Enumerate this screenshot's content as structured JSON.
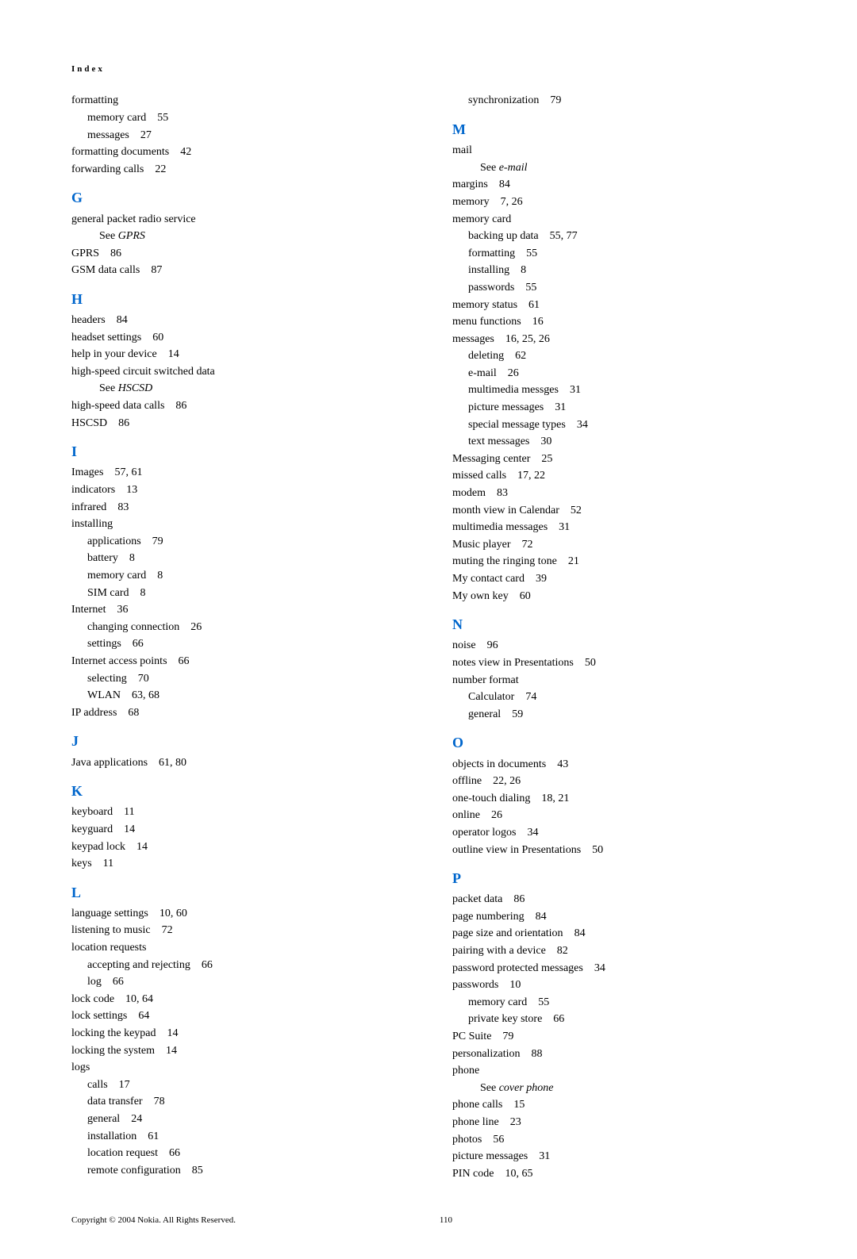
{
  "header": "Index",
  "columns": [
    [
      {
        "type": "entry",
        "text": "formatting"
      },
      {
        "type": "sub",
        "text": "memory card",
        "pages": "55"
      },
      {
        "type": "sub",
        "text": "messages",
        "pages": "27"
      },
      {
        "type": "entry",
        "text": "formatting documents",
        "pages": "42"
      },
      {
        "type": "entry",
        "text": "forwarding calls",
        "pages": "22"
      },
      {
        "type": "letter",
        "text": "G"
      },
      {
        "type": "entry",
        "text": "general packet radio service"
      },
      {
        "type": "see",
        "prefix": "See ",
        "italic": "GPRS"
      },
      {
        "type": "entry",
        "text": "GPRS",
        "pages": "86"
      },
      {
        "type": "entry",
        "text": "GSM data calls",
        "pages": "87"
      },
      {
        "type": "letter",
        "text": "H"
      },
      {
        "type": "entry",
        "text": "headers",
        "pages": "84"
      },
      {
        "type": "entry",
        "text": "headset settings",
        "pages": "60"
      },
      {
        "type": "entry",
        "text": "help in your device",
        "pages": "14"
      },
      {
        "type": "entry",
        "text": "high-speed circuit switched data"
      },
      {
        "type": "see",
        "prefix": "See ",
        "italic": "HSCSD"
      },
      {
        "type": "entry",
        "text": "high-speed data calls",
        "pages": "86"
      },
      {
        "type": "entry",
        "text": "HSCSD",
        "pages": "86"
      },
      {
        "type": "letter",
        "text": "I"
      },
      {
        "type": "entry",
        "text": "Images",
        "pages": "57, 61"
      },
      {
        "type": "entry",
        "text": "indicators",
        "pages": "13"
      },
      {
        "type": "entry",
        "text": "infrared",
        "pages": "83"
      },
      {
        "type": "entry",
        "text": "installing"
      },
      {
        "type": "sub",
        "text": "applications",
        "pages": "79"
      },
      {
        "type": "sub",
        "text": "battery",
        "pages": "8"
      },
      {
        "type": "sub",
        "text": "memory card",
        "pages": "8"
      },
      {
        "type": "sub",
        "text": "SIM card",
        "pages": "8"
      },
      {
        "type": "entry",
        "text": "Internet",
        "pages": "36"
      },
      {
        "type": "sub",
        "text": "changing connection",
        "pages": "26"
      },
      {
        "type": "sub",
        "text": "settings",
        "pages": "66"
      },
      {
        "type": "entry",
        "text": "Internet access points",
        "pages": "66"
      },
      {
        "type": "sub",
        "text": "selecting",
        "pages": "70"
      },
      {
        "type": "sub",
        "text": "WLAN",
        "pages": "63, 68"
      },
      {
        "type": "entry",
        "text": "IP address",
        "pages": "68"
      },
      {
        "type": "letter",
        "text": "J"
      },
      {
        "type": "entry",
        "text": "Java applications",
        "pages": "61, 80"
      },
      {
        "type": "letter",
        "text": "K"
      },
      {
        "type": "entry",
        "text": "keyboard",
        "pages": "11"
      },
      {
        "type": "entry",
        "text": "keyguard",
        "pages": "14"
      },
      {
        "type": "entry",
        "text": "keypad lock",
        "pages": "14"
      },
      {
        "type": "entry",
        "text": "keys",
        "pages": "11"
      },
      {
        "type": "letter",
        "text": "L"
      },
      {
        "type": "entry",
        "text": "language settings",
        "pages": "10, 60"
      },
      {
        "type": "entry",
        "text": "listening to music",
        "pages": "72"
      },
      {
        "type": "entry",
        "text": "location requests"
      },
      {
        "type": "sub",
        "text": "accepting and rejecting",
        "pages": "66"
      },
      {
        "type": "sub",
        "text": "log",
        "pages": "66"
      },
      {
        "type": "entry",
        "text": "lock code",
        "pages": "10, 64"
      },
      {
        "type": "entry",
        "text": "lock settings",
        "pages": "64"
      },
      {
        "type": "entry",
        "text": "locking the keypad",
        "pages": "14"
      },
      {
        "type": "entry",
        "text": "locking the system",
        "pages": "14"
      },
      {
        "type": "entry",
        "text": "logs"
      },
      {
        "type": "sub",
        "text": "calls",
        "pages": "17"
      },
      {
        "type": "sub",
        "text": "data transfer",
        "pages": "78"
      },
      {
        "type": "sub",
        "text": "general",
        "pages": "24"
      },
      {
        "type": "sub",
        "text": "installation",
        "pages": "61"
      },
      {
        "type": "sub",
        "text": "location request",
        "pages": "66"
      },
      {
        "type": "sub",
        "text": "remote configuration",
        "pages": "85"
      }
    ],
    [
      {
        "type": "sub",
        "text": "synchronization",
        "pages": "79"
      },
      {
        "type": "letter",
        "text": "M"
      },
      {
        "type": "entry",
        "text": "mail"
      },
      {
        "type": "see",
        "prefix": "See ",
        "italic": "e-mail"
      },
      {
        "type": "entry",
        "text": "margins",
        "pages": "84"
      },
      {
        "type": "entry",
        "text": "memory",
        "pages": "7, 26"
      },
      {
        "type": "entry",
        "text": "memory card"
      },
      {
        "type": "sub",
        "text": "backing up data",
        "pages": "55, 77"
      },
      {
        "type": "sub",
        "text": "formatting",
        "pages": "55"
      },
      {
        "type": "sub",
        "text": "installing",
        "pages": "8"
      },
      {
        "type": "sub",
        "text": "passwords",
        "pages": "55"
      },
      {
        "type": "entry",
        "text": "memory status",
        "pages": "61"
      },
      {
        "type": "entry",
        "text": "menu functions",
        "pages": "16"
      },
      {
        "type": "entry",
        "text": "messages",
        "pages": "16, 25, 26"
      },
      {
        "type": "sub",
        "text": "deleting",
        "pages": "62"
      },
      {
        "type": "sub",
        "text": "e-mail",
        "pages": "26"
      },
      {
        "type": "sub",
        "text": "multimedia messges",
        "pages": "31"
      },
      {
        "type": "sub",
        "text": "picture messages",
        "pages": "31"
      },
      {
        "type": "sub",
        "text": "special message types",
        "pages": "34"
      },
      {
        "type": "sub",
        "text": "text messages",
        "pages": "30"
      },
      {
        "type": "entry",
        "text": "Messaging center",
        "pages": "25"
      },
      {
        "type": "entry",
        "text": "missed calls",
        "pages": "17, 22"
      },
      {
        "type": "entry",
        "text": "modem",
        "pages": "83"
      },
      {
        "type": "entry",
        "text": "month view in Calendar",
        "pages": "52"
      },
      {
        "type": "entry",
        "text": "multimedia messages",
        "pages": "31"
      },
      {
        "type": "entry",
        "text": "Music player",
        "pages": "72"
      },
      {
        "type": "entry",
        "text": "muting the ringing tone",
        "pages": "21"
      },
      {
        "type": "entry",
        "text": "My contact card",
        "pages": "39"
      },
      {
        "type": "entry",
        "text": "My own key",
        "pages": "60"
      },
      {
        "type": "letter",
        "text": "N"
      },
      {
        "type": "entry",
        "text": "noise",
        "pages": "96"
      },
      {
        "type": "entry",
        "text": "notes view in Presentations",
        "pages": "50"
      },
      {
        "type": "entry",
        "text": "number format"
      },
      {
        "type": "sub",
        "text": "Calculator",
        "pages": "74"
      },
      {
        "type": "sub",
        "text": "general",
        "pages": "59"
      },
      {
        "type": "letter",
        "text": "O"
      },
      {
        "type": "entry",
        "text": "objects in documents",
        "pages": "43"
      },
      {
        "type": "entry",
        "text": "offline",
        "pages": "22, 26"
      },
      {
        "type": "entry",
        "text": "one-touch dialing",
        "pages": "18, 21"
      },
      {
        "type": "entry",
        "text": "online",
        "pages": "26"
      },
      {
        "type": "entry",
        "text": "operator logos",
        "pages": "34"
      },
      {
        "type": "entry",
        "text": "outline view in Presentations",
        "pages": "50"
      },
      {
        "type": "letter",
        "text": "P"
      },
      {
        "type": "entry",
        "text": "packet data",
        "pages": "86"
      },
      {
        "type": "entry",
        "text": "page numbering",
        "pages": "84"
      },
      {
        "type": "entry",
        "text": "page size and orientation",
        "pages": "84"
      },
      {
        "type": "entry",
        "text": "pairing with a device",
        "pages": "82"
      },
      {
        "type": "entry",
        "text": "password protected messages",
        "pages": "34"
      },
      {
        "type": "entry",
        "text": "passwords",
        "pages": "10"
      },
      {
        "type": "sub",
        "text": "memory card",
        "pages": "55"
      },
      {
        "type": "sub",
        "text": "private key store",
        "pages": "66"
      },
      {
        "type": "entry",
        "text": "PC Suite",
        "pages": "79"
      },
      {
        "type": "entry",
        "text": "personalization",
        "pages": "88"
      },
      {
        "type": "entry",
        "text": "phone"
      },
      {
        "type": "see",
        "prefix": "See ",
        "italic": "cover phone"
      },
      {
        "type": "entry",
        "text": "phone calls",
        "pages": "15"
      },
      {
        "type": "entry",
        "text": "phone line",
        "pages": "23"
      },
      {
        "type": "entry",
        "text": "photos",
        "pages": "56"
      },
      {
        "type": "entry",
        "text": "picture messages",
        "pages": "31"
      },
      {
        "type": "entry",
        "text": "PIN code",
        "pages": "10, 65"
      }
    ]
  ],
  "footer": {
    "copyright": "Copyright © 2004 Nokia. All Rights Reserved.",
    "page": "110"
  }
}
